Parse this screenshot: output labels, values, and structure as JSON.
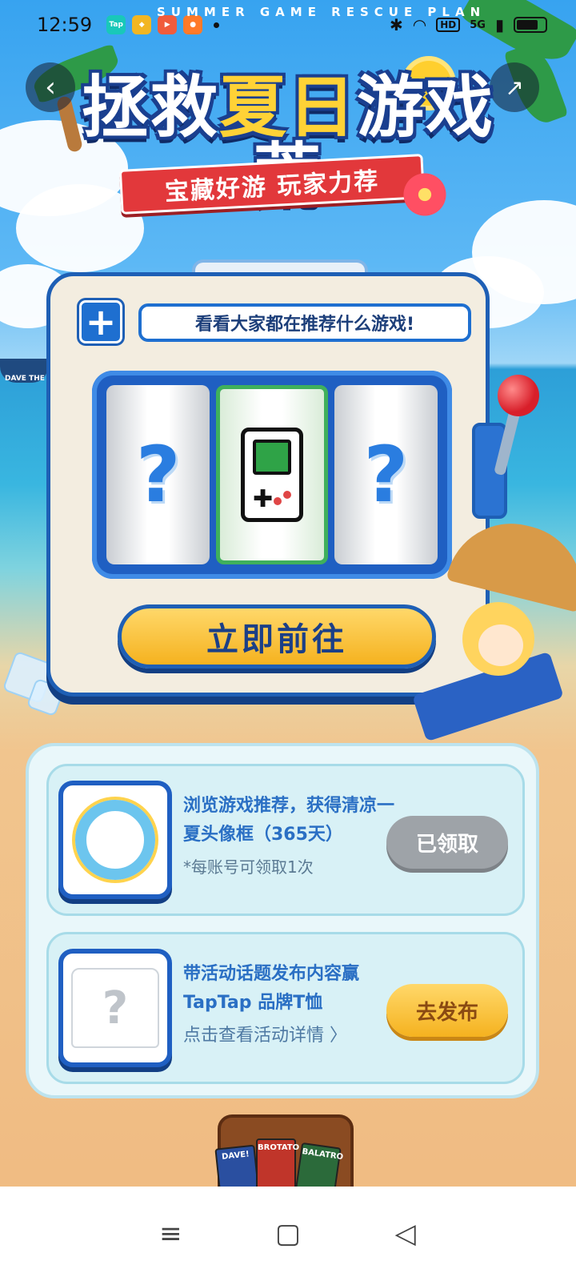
{
  "status_bar": {
    "time": "12:59",
    "apps": [
      {
        "icon": "taptap-app-icon",
        "label": "Tap",
        "color": "#19c8b9"
      },
      {
        "icon": "diamond-app-icon",
        "label": "",
        "color": "#f2b622"
      },
      {
        "icon": "game-app-icon",
        "label": "",
        "color": "#f05c3c"
      },
      {
        "icon": "kuaishou-app-icon",
        "label": "",
        "color": "#ff7a29"
      }
    ],
    "network": "5G",
    "hd_label": "HD"
  },
  "header": {
    "tagline": "SUMMER GAME RESCUE PLAN",
    "title_part1": "拯救",
    "title_highlight": "夏日",
    "title_part2": "游戏荒",
    "ribbon": "宝藏好游 玩家力荐"
  },
  "slot_machine": {
    "bubble_text": "看看大家都在推荐什么游戏!",
    "reel_left": "?",
    "reel_right": "?",
    "go_button": "立即前往"
  },
  "rewards": [
    {
      "title": "浏览游戏推荐，获得清凉一夏头像框（365天）",
      "note": "*每账号可领取1次",
      "button": "已领取",
      "state": "claimed"
    },
    {
      "title": "带活动话题发布内容赢 TapTap 品牌T恤",
      "link": "点击查看活动详情 〉",
      "button": "去发布",
      "state": "active"
    }
  ],
  "decor": {
    "boat_label": "DAVE THE DI",
    "chest_cards": [
      "DAVE!",
      "BROTATO",
      "BALATRO"
    ]
  },
  "nav": {
    "back": "≡",
    "home": "▢",
    "recent": "◁"
  },
  "colors": {
    "brand_blue": "#1e5fb5",
    "accent_yellow": "#f5b21f",
    "claimed_gray": "#9ea3a8"
  }
}
